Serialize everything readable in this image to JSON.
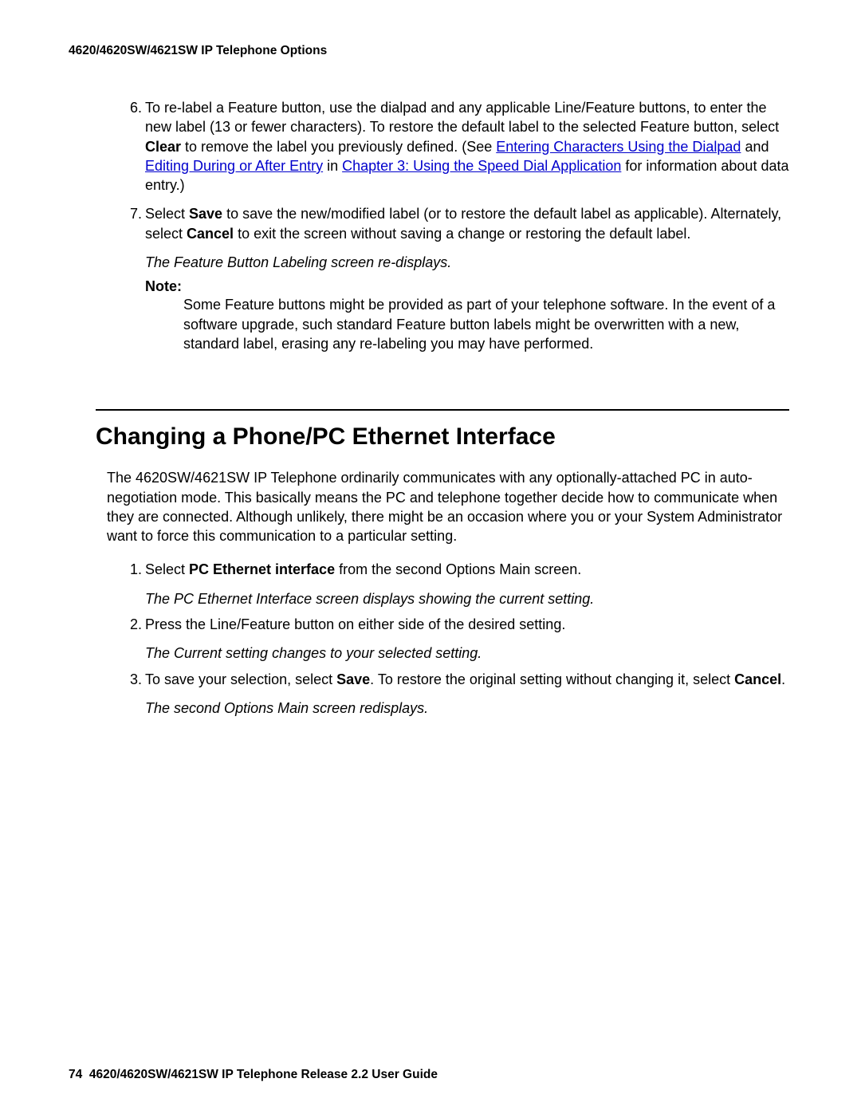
{
  "header": {
    "section_title": "4620/4620SW/4621SW IP Telephone Options"
  },
  "steps_top": [
    {
      "number": "6.",
      "parts": [
        {
          "type": "text",
          "value": "To re-label a Feature button, use the dialpad and any applicable Line/Feature buttons, to enter the new label (13 or fewer characters). To restore the default label to the selected Feature button, select "
        },
        {
          "type": "bold",
          "value": "Clear"
        },
        {
          "type": "text",
          "value": " to remove the label you previously defined. (See "
        },
        {
          "type": "link",
          "value": "Entering Characters Using the Dialpad"
        },
        {
          "type": "text",
          "value": " and "
        },
        {
          "type": "link",
          "value": "Editing During or After Entry"
        },
        {
          "type": "text",
          "value": " in "
        },
        {
          "type": "link",
          "value": "Chapter 3: Using the Speed Dial Application"
        },
        {
          "type": "text",
          "value": " for information about data entry.)"
        }
      ]
    },
    {
      "number": "7.",
      "parts": [
        {
          "type": "text",
          "value": "Select "
        },
        {
          "type": "bold",
          "value": "Save"
        },
        {
          "type": "text",
          "value": " to save the new/modified label (or to restore the default label as applicable). Alternately, select "
        },
        {
          "type": "bold",
          "value": "Cancel"
        },
        {
          "type": "text",
          "value": " to exit the screen without saving a change or restoring the default label."
        }
      ]
    }
  ],
  "result_top": "The Feature Button Labeling screen re-displays.",
  "note": {
    "label": "Note:",
    "text": "Some Feature buttons might be provided as part of your telephone software. In the event of a software upgrade, such standard Feature button labels might be overwritten with a new, standard label, erasing any re-labeling you may have performed."
  },
  "section": {
    "heading": "Changing a Phone/PC Ethernet Interface",
    "intro": "The 4620SW/4621SW IP Telephone ordinarily communicates with any optionally-attached PC in auto-negotiation mode. This basically means the PC and telephone together decide how to communicate when they are connected. Although unlikely, there might be an occasion where you or your System Administrator want to force this communication to a particular setting."
  },
  "steps_section": [
    {
      "number": "1.",
      "parts": [
        {
          "type": "text",
          "value": "Select "
        },
        {
          "type": "bold",
          "value": "PC Ethernet interface"
        },
        {
          "type": "text",
          "value": " from the second Options Main screen."
        }
      ],
      "result": "The PC Ethernet Interface screen displays showing the current setting."
    },
    {
      "number": "2.",
      "parts": [
        {
          "type": "text",
          "value": "Press the Line/Feature button on either side of the desired setting."
        }
      ],
      "result": "The Current setting changes to your selected setting."
    },
    {
      "number": "3.",
      "parts": [
        {
          "type": "text",
          "value": "To save your selection, select "
        },
        {
          "type": "bold",
          "value": "Save"
        },
        {
          "type": "text",
          "value": ". To restore the original setting without changing it, select "
        },
        {
          "type": "bold",
          "value": "Cancel"
        },
        {
          "type": "text",
          "value": "."
        }
      ],
      "result": "The second Options Main screen redisplays."
    }
  ],
  "footer": {
    "page_number": "74",
    "doc_title": "4620/4620SW/4621SW IP Telephone Release 2.2 User Guide"
  }
}
